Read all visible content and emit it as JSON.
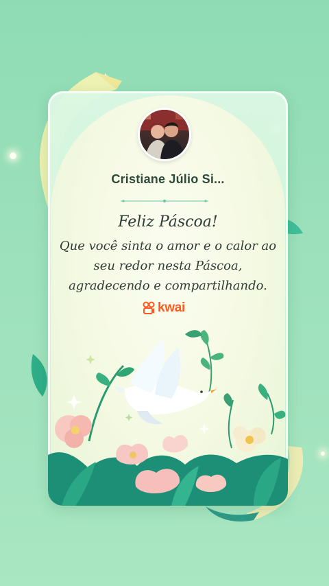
{
  "card": {
    "username": "Cristiane Júlio Si...",
    "greeting_title": "Feliz Páscoa!",
    "greeting_lines": [
      "Que você sinta o amor e o calor ao",
      "seu redor nesta Páscoa,",
      "agradecendo e compartilhando."
    ],
    "brand_name": "kwai"
  },
  "icons": {
    "avatar": "profile-photo",
    "brand_logo": "kwai-logo-icon",
    "illustration": "dove-and-flowers"
  },
  "colors": {
    "background": "#9be0bb",
    "card": "#dcf8e4",
    "brand": "#ff5a1f",
    "text": "#2f3b36"
  }
}
